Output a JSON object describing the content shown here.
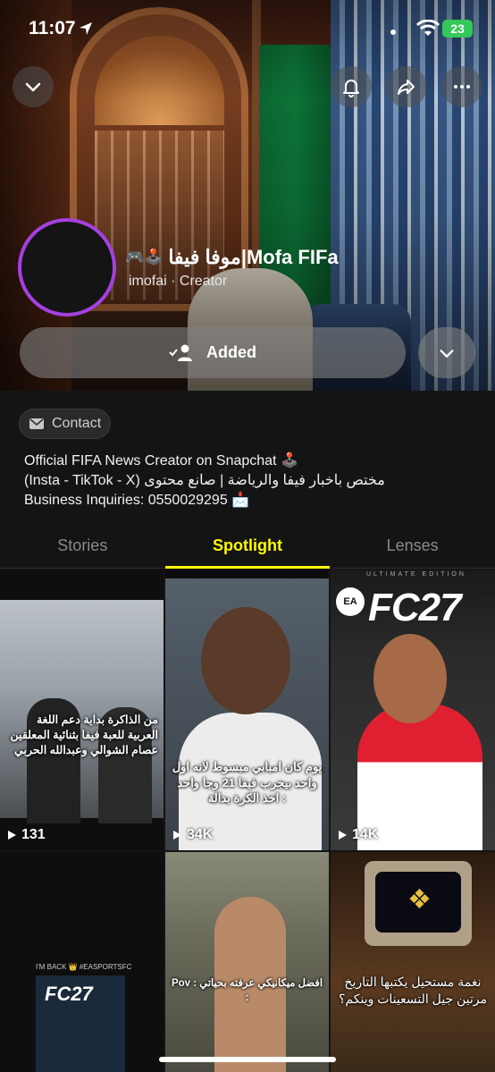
{
  "status_bar": {
    "time": "11:07",
    "battery": "23"
  },
  "profile": {
    "display_name": "موفا فيفا|Mofa FIFa",
    "name_emoji": "🎮🕹️",
    "username": "imofai",
    "role": "Creator",
    "subline": "imofai · Creator",
    "added_label": "Added"
  },
  "contact_label": "Contact",
  "bio": [
    "Official FIFA News Creator on Snapchat 🕹️",
    "مختص باخبار فيفا والرياضة | صانع محتوى (Insta - TikTok - X)",
    "Business Inquiries: 0550029295 📩"
  ],
  "tabs": [
    {
      "label": "Stories",
      "active": false
    },
    {
      "label": "Spotlight",
      "active": true
    },
    {
      "label": "Lenses",
      "active": false
    }
  ],
  "tiles": [
    {
      "views": "131",
      "caption": "من الذاكرة بداية دعم اللغة العربية للعبة فيفا بثنائية المعلقين عصام الشوالي وعبدالله الحربي"
    },
    {
      "views": "34K",
      "caption": "يوم كان امبابي مبسوط لانه اول واحد بيجرب فيفا 21 وجا واحد اخذ الكرة بدالة :"
    },
    {
      "views": "14K",
      "caption": "",
      "logo": "FC27",
      "edition": "ULTIMATE EDITION"
    },
    {
      "views": "",
      "caption": "",
      "logo": "FC27",
      "tweet": "I'M BACK 👑 #EASPORTSFC"
    },
    {
      "views": "",
      "caption": "Pov : افضل ميكانيكي عرفته بحياتي :"
    },
    {
      "views": "",
      "caption": "نغمة مستحيل يكتبها التاريخ مرتين جيل التسعينات وينكم؟"
    }
  ],
  "colors": {
    "accent": "#fffc00",
    "avatar_ring": "#a540e0",
    "battery": "#34c759"
  },
  "icons": [
    "location-arrow-icon",
    "wifi-icon",
    "chevron-down-icon",
    "bell-icon",
    "share-icon",
    "more-icon",
    "added-friend-icon",
    "mail-icon",
    "play-icon"
  ]
}
